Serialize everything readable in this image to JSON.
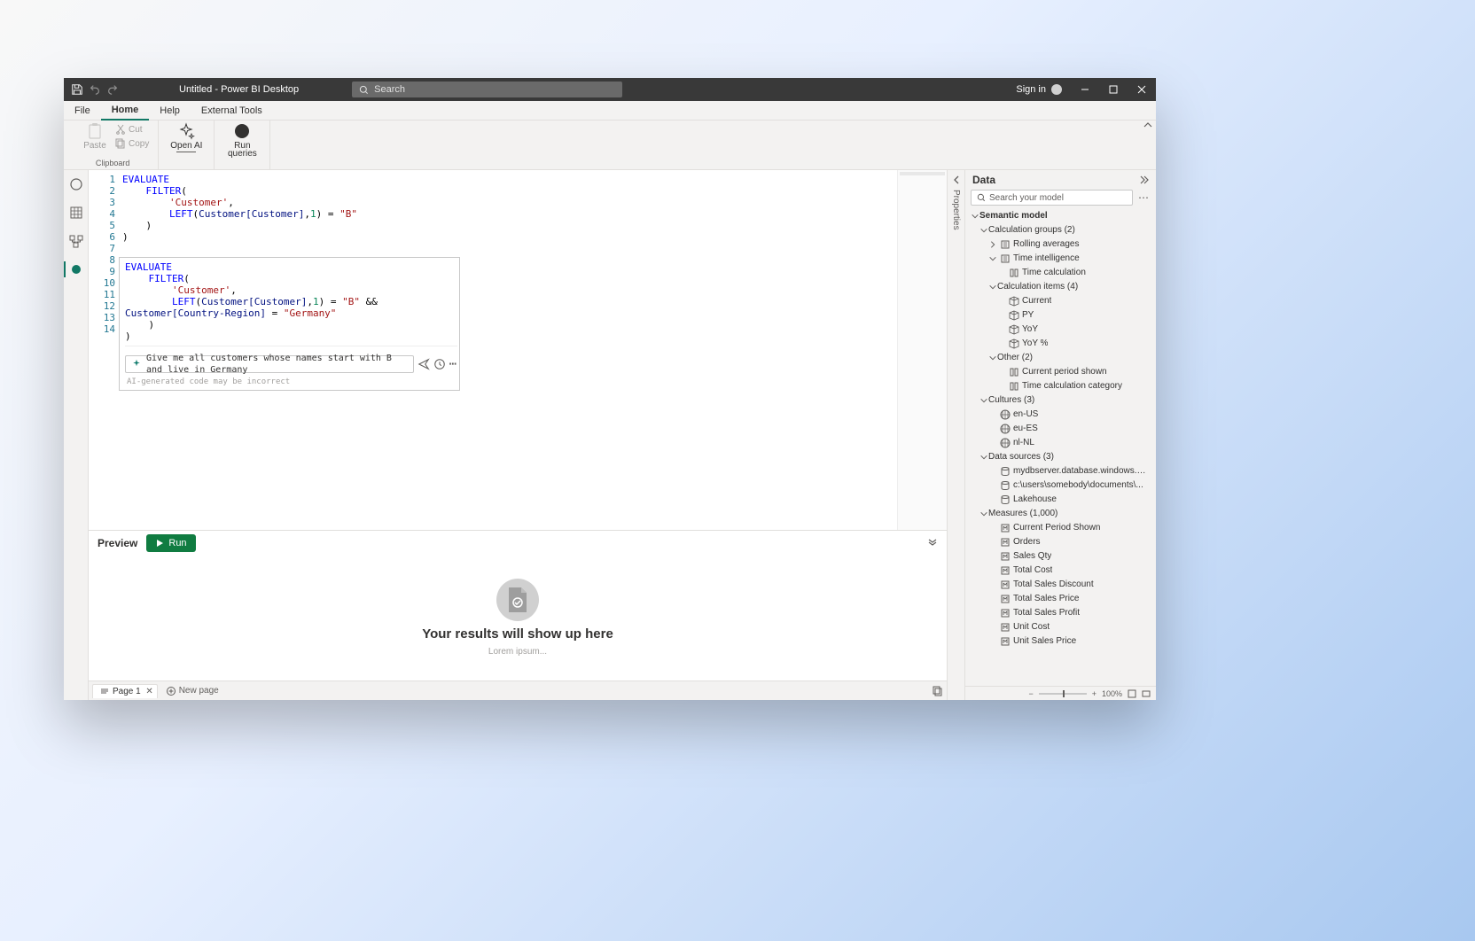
{
  "titlebar": {
    "title": "Untitled - Power BI Desktop",
    "search_placeholder": "Search",
    "sign_in": "Sign in"
  },
  "ribbon": {
    "tabs": [
      "File",
      "Home",
      "Help",
      "External Tools"
    ],
    "active_tab": 1,
    "clipboard": {
      "label": "Clipboard",
      "paste": "Paste",
      "cut": "Cut",
      "copy": "Copy"
    },
    "open_ai": "Open AI",
    "run_queries": "Run queries"
  },
  "code": {
    "lines": [
      "1",
      "2",
      "3",
      "4",
      "5",
      "6",
      "7",
      "8",
      "9",
      "10",
      "11",
      "12",
      "13",
      "14"
    ]
  },
  "ai": {
    "prompt": "Give me all customers whose names start with B and live in Germany",
    "disclaimer": "AI-generated code may be incorrect"
  },
  "preview": {
    "label": "Preview",
    "run": "Run",
    "title": "Your results will show up here",
    "subtitle": "Lorem ipsum..."
  },
  "pages": {
    "current": "Page 1",
    "new_page": "New page"
  },
  "properties": {
    "label": "Properties"
  },
  "data_panel": {
    "title": "Data",
    "search_placeholder": "Search your model",
    "tree": [
      {
        "d": 0,
        "chev": "v",
        "bold": true,
        "ic": "",
        "label": "Semantic model"
      },
      {
        "d": 1,
        "chev": "v",
        "bold": false,
        "ic": "",
        "label": "Calculation groups (2)"
      },
      {
        "d": 2,
        "chev": ">",
        "bold": false,
        "ic": "calc",
        "label": "Rolling averages"
      },
      {
        "d": 2,
        "chev": "v",
        "bold": false,
        "ic": "calc",
        "label": "Time intelligence"
      },
      {
        "d": 3,
        "chev": "",
        "bold": false,
        "ic": "col",
        "label": "Time calculation"
      },
      {
        "d": 2,
        "chev": "v",
        "bold": false,
        "ic": "",
        "label": "Calculation items (4)"
      },
      {
        "d": 3,
        "chev": "",
        "bold": false,
        "ic": "cube",
        "label": "Current"
      },
      {
        "d": 3,
        "chev": "",
        "bold": false,
        "ic": "cube",
        "label": "PY"
      },
      {
        "d": 3,
        "chev": "",
        "bold": false,
        "ic": "cube",
        "label": "YoY"
      },
      {
        "d": 3,
        "chev": "",
        "bold": false,
        "ic": "cube",
        "label": "YoY %"
      },
      {
        "d": 2,
        "chev": "v",
        "bold": false,
        "ic": "",
        "label": "Other (2)"
      },
      {
        "d": 3,
        "chev": "",
        "bold": false,
        "ic": "col",
        "label": "Current period shown"
      },
      {
        "d": 3,
        "chev": "",
        "bold": false,
        "ic": "col",
        "label": "Time calculation category"
      },
      {
        "d": 1,
        "chev": "v",
        "bold": false,
        "ic": "",
        "label": "Cultures (3)"
      },
      {
        "d": 2,
        "chev": "",
        "bold": false,
        "ic": "globe",
        "label": "en-US"
      },
      {
        "d": 2,
        "chev": "",
        "bold": false,
        "ic": "globe",
        "label": "eu-ES"
      },
      {
        "d": 2,
        "chev": "",
        "bold": false,
        "ic": "globe",
        "label": "nl-NL"
      },
      {
        "d": 1,
        "chev": "v",
        "bold": false,
        "ic": "",
        "label": "Data sources (3)"
      },
      {
        "d": 2,
        "chev": "",
        "bold": false,
        "ic": "db",
        "label": "mydbserver.database.windows.net;MyData..."
      },
      {
        "d": 2,
        "chev": "",
        "bold": false,
        "ic": "db",
        "label": "c:\\users\\somebody\\documents\\..."
      },
      {
        "d": 2,
        "chev": "",
        "bold": false,
        "ic": "db",
        "label": "Lakehouse"
      },
      {
        "d": 1,
        "chev": "v",
        "bold": false,
        "ic": "",
        "label": "Measures (1,000)"
      },
      {
        "d": 2,
        "chev": "",
        "bold": false,
        "ic": "m",
        "label": "Current Period Shown"
      },
      {
        "d": 2,
        "chev": "",
        "bold": false,
        "ic": "m",
        "label": "Orders"
      },
      {
        "d": 2,
        "chev": "",
        "bold": false,
        "ic": "m",
        "label": "Sales Qty"
      },
      {
        "d": 2,
        "chev": "",
        "bold": false,
        "ic": "m",
        "label": "Total Cost"
      },
      {
        "d": 2,
        "chev": "",
        "bold": false,
        "ic": "m",
        "label": "Total Sales Discount"
      },
      {
        "d": 2,
        "chev": "",
        "bold": false,
        "ic": "m",
        "label": "Total Sales Price"
      },
      {
        "d": 2,
        "chev": "",
        "bold": false,
        "ic": "m",
        "label": "Total Sales Profit"
      },
      {
        "d": 2,
        "chev": "",
        "bold": false,
        "ic": "m",
        "label": "Unit Cost"
      },
      {
        "d": 2,
        "chev": "",
        "bold": false,
        "ic": "m",
        "label": "Unit Sales Price"
      }
    ]
  },
  "zoom": {
    "percent": "100%"
  }
}
